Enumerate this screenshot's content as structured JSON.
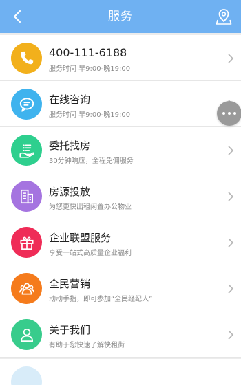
{
  "header": {
    "title": "服务"
  },
  "colors": {
    "header": "#6fb1f2"
  },
  "items": [
    {
      "title": "400-111-6188",
      "subtitle": "服务时间 早9:00-晚19:00",
      "icon": "phone-icon",
      "color": "#f2b01c"
    },
    {
      "title": "在线咨询",
      "subtitle": "服务时间 早9:00-晚19:00",
      "icon": "chat-icon",
      "color": "#3fb3ee"
    },
    {
      "title": "委托找房",
      "subtitle": "30分钟响应，全程免佣服务",
      "icon": "hand-list-icon",
      "color": "#2ecf8e"
    },
    {
      "title": "房源投放",
      "subtitle": "为您更快出租闲置办公物业",
      "icon": "building-icon",
      "color": "#a574e0"
    },
    {
      "title": "企业联盟服务",
      "subtitle": "享受一站式高质量企业福利",
      "icon": "gift-icon",
      "color": "#ef2c57"
    },
    {
      "title": "全民营销",
      "subtitle": "动动手指，即可参加“全民经纪人”",
      "icon": "group-icon",
      "color": "#f57b1c"
    },
    {
      "title": "关于我们",
      "subtitle": "有助于您快速了解快租街",
      "icon": "person-icon",
      "color": "#38cc8c"
    }
  ]
}
